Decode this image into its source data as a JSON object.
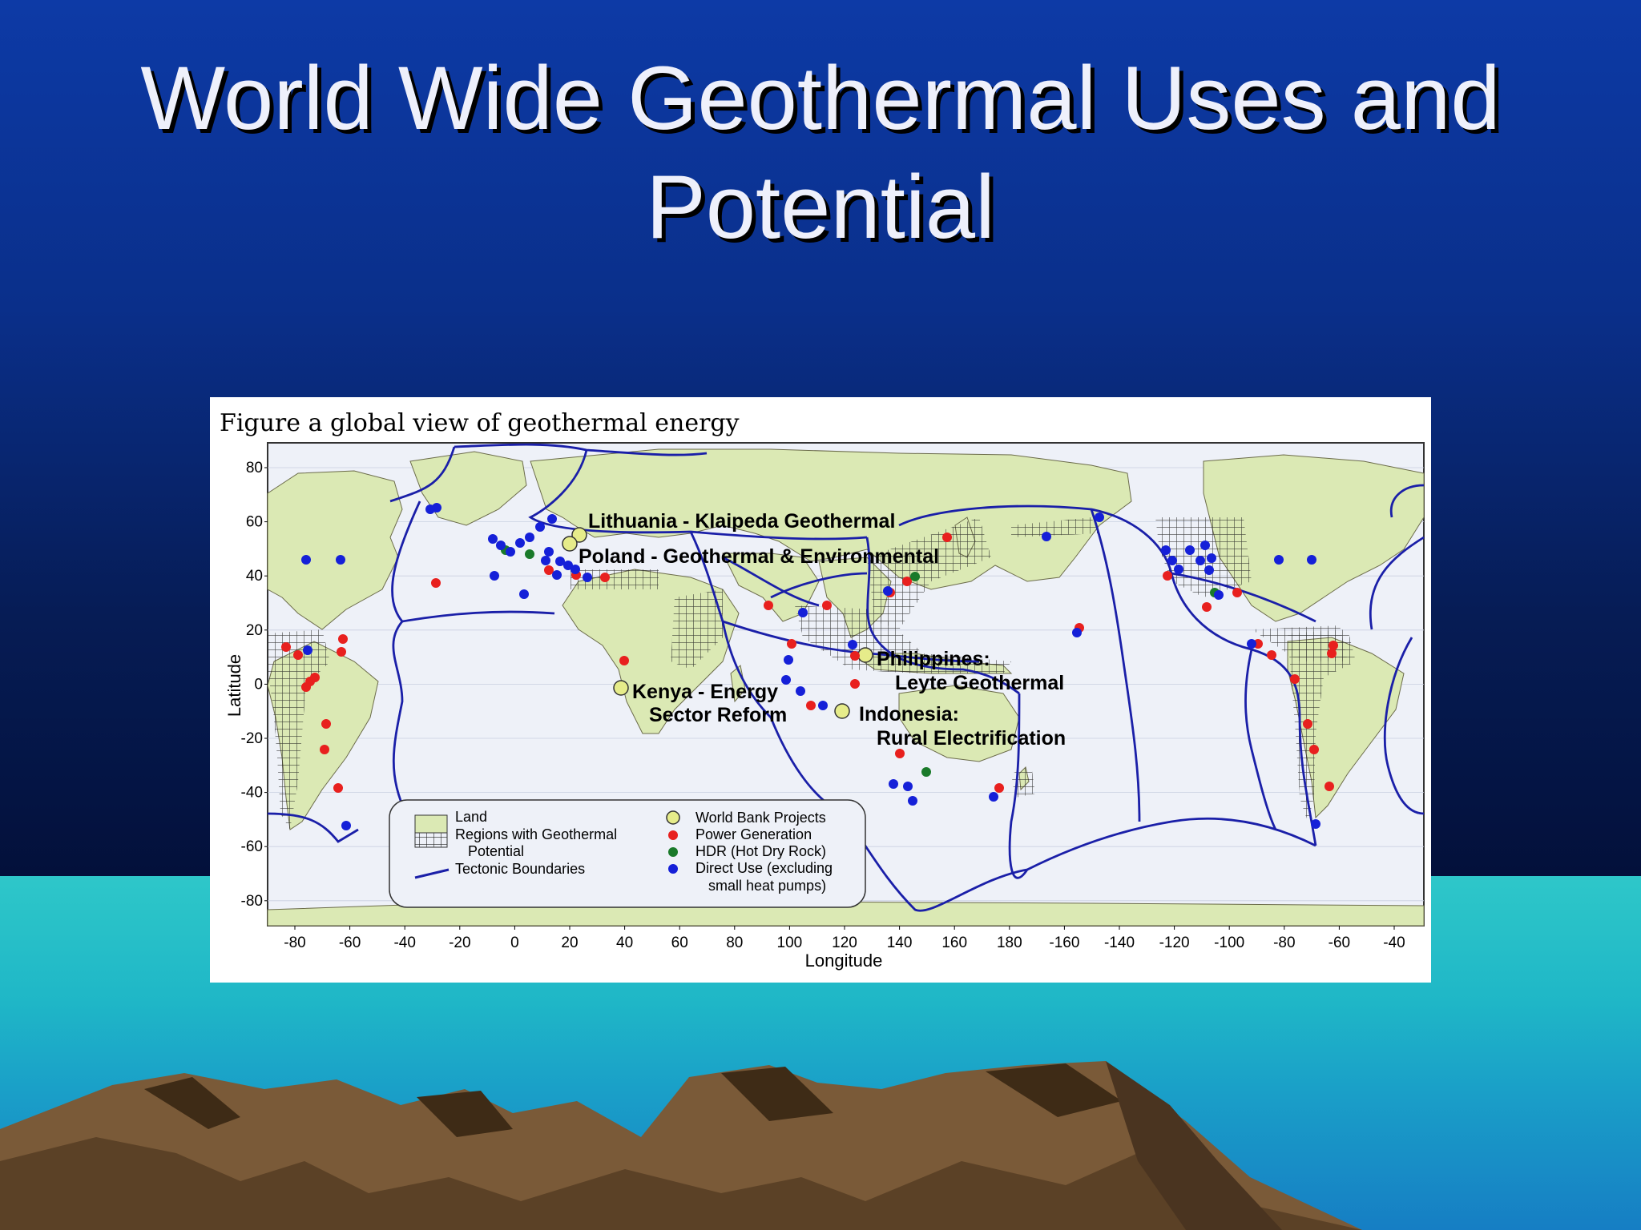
{
  "slide": {
    "title_line1": "World Wide Geothermal Uses and",
    "title_line2": "Potential"
  },
  "figure": {
    "caption": "Figure a global view of geothermal energy"
  },
  "map": {
    "y_axis_label": "Latitude",
    "x_axis_label": "Longitude",
    "y_ticks": [
      "80",
      "60",
      "40",
      "20",
      "0",
      "-20",
      "-40",
      "-60",
      "-80"
    ],
    "x_ticks": [
      "-80",
      "-60",
      "-40",
      "-20",
      "0",
      "20",
      "40",
      "60",
      "80",
      "100",
      "120",
      "140",
      "160",
      "180",
      "-160",
      "-140",
      "-120",
      "-100",
      "-80",
      "-60",
      "-40"
    ],
    "callouts": [
      {
        "id": "lithuania",
        "line1": "Lithuania - Klaipeda Geothermal",
        "line2": ""
      },
      {
        "id": "poland",
        "line1": "Poland - Geothermal & Environmental",
        "line2": ""
      },
      {
        "id": "philippines",
        "line1": "Philippines:",
        "line2": "Leyte Geothermal"
      },
      {
        "id": "kenya",
        "line1": "Kenya - Energy",
        "line2": "Sector Reform"
      },
      {
        "id": "indonesia",
        "line1": "Indonesia:",
        "line2": "Rural Electrification"
      }
    ],
    "legend": {
      "land": "Land",
      "regions_line1": "Regions with Geothermal",
      "regions_line2": "Potential",
      "tectonic": "Tectonic Boundaries",
      "world_bank": "World Bank Projects",
      "power": "Power Generation",
      "hdr": "HDR (Hot Dry Rock)",
      "direct_line1": "Direct Use (excluding",
      "direct_line2": "small heat pumps)"
    },
    "colors": {
      "land": "#dbe9b4",
      "ocean": "#eef1f8",
      "tectonic": "#1a1fa8",
      "world_bank": "#e6ec8a",
      "power": "#e8201e",
      "hdr": "#1a7a2a",
      "direct": "#1520d8"
    }
  }
}
